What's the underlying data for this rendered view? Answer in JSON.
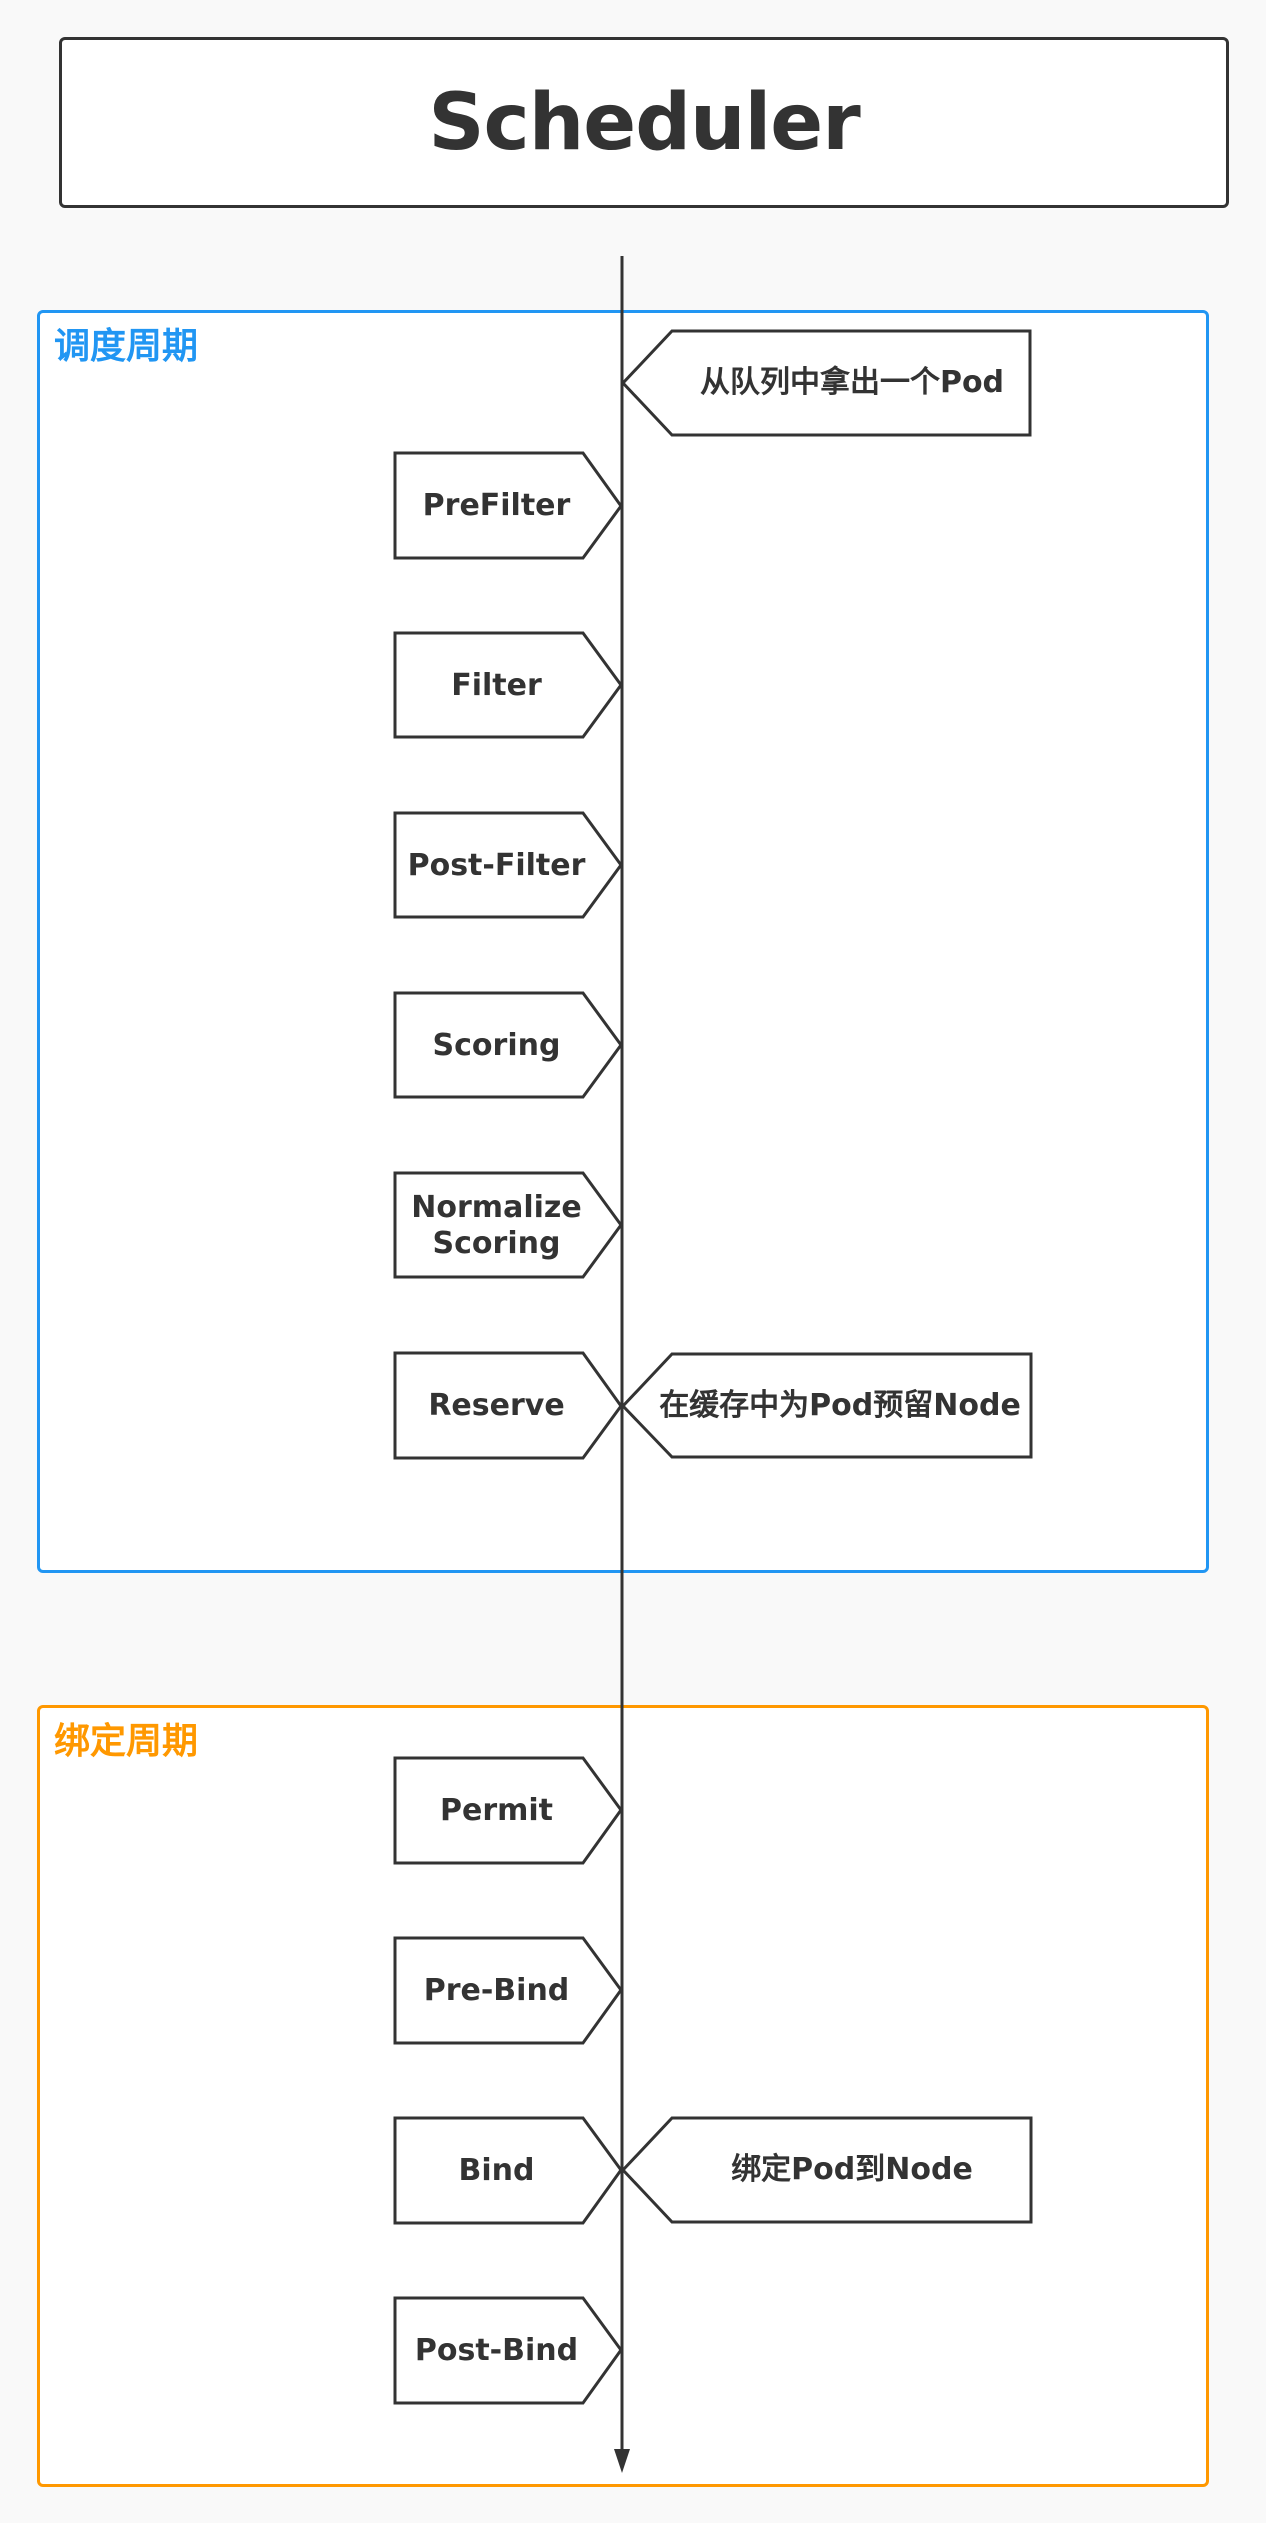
{
  "title": "Scheduler",
  "colors": {
    "line": "#333333",
    "scheduling_cycle": "#2196F3",
    "binding_cycle": "#FF9800",
    "background": "#f9f9f9"
  },
  "phases": [
    {
      "id": "scheduling",
      "label": "调度周期",
      "steps": [
        "PreFilter",
        "Filter",
        "Post-Filter",
        "Scoring",
        "Normalize Scoring",
        "Reserve"
      ]
    },
    {
      "id": "binding",
      "label": "绑定周期",
      "steps": [
        "Permit",
        "Pre-Bind",
        "Bind",
        "Post-Bind"
      ]
    }
  ],
  "steps": {
    "prefilter": "PreFilter",
    "filter": "Filter",
    "post_filter": "Post-Filter",
    "scoring": "Scoring",
    "normalize_scoring": "Normalize\nScoring",
    "reserve": "Reserve",
    "permit": "Permit",
    "pre_bind": "Pre-Bind",
    "bind": "Bind",
    "post_bind": "Post-Bind"
  },
  "notes": {
    "dequeue": "从队列中拿出一个Pod",
    "reserve": "在缓存中为Pod预留Node",
    "bind": "绑定Pod到Node"
  }
}
